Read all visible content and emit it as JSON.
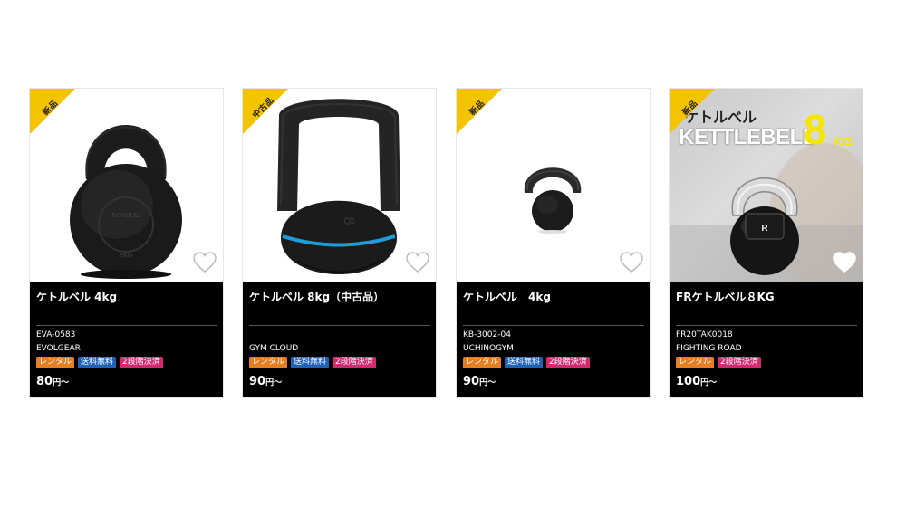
{
  "products": [
    {
      "badge": "新品",
      "name": "ケトルベル 4kg",
      "code": "EVA-0583",
      "brand": "EVOLGEAR",
      "tags": [
        "レンタル",
        "送料無料",
        "2段階決済"
      ],
      "price": "80",
      "unit": "円～"
    },
    {
      "badge": "中古品",
      "name": "ケトルベル 8kg（中古品）",
      "code": "",
      "brand": "GYM CLOUD",
      "tags": [
        "レンタル",
        "送料無料",
        "2段階決済"
      ],
      "price": "90",
      "unit": "円～"
    },
    {
      "badge": "新品",
      "name": "ケトルベル　4kg",
      "code": "KB-3002-04",
      "brand": "UCHINOGYM",
      "tags": [
        "レンタル",
        "送料無料",
        "2段階決済"
      ],
      "price": "90",
      "unit": "円～"
    },
    {
      "badge": "新品",
      "name": "FRケトルベル８KG",
      "code": "FR20TAK0018",
      "brand": "FIGHTING ROAD",
      "tags": [
        "レンタル",
        "2段階決済"
      ],
      "price": "100",
      "unit": "円～",
      "image_banner": {
        "line1": "ケトルベル",
        "line2": "KETTLEBELL",
        "big": "8",
        "unit": "KG"
      }
    }
  ],
  "colors": {
    "badge_new": "#f5c400",
    "tag_rental": "#e67e22",
    "tag_shipping": "#1f63b8",
    "tag_payment": "#d6286e",
    "accent_blue": "#1e9ed8"
  },
  "icons": {
    "favorite": "heart-outline-icon"
  }
}
